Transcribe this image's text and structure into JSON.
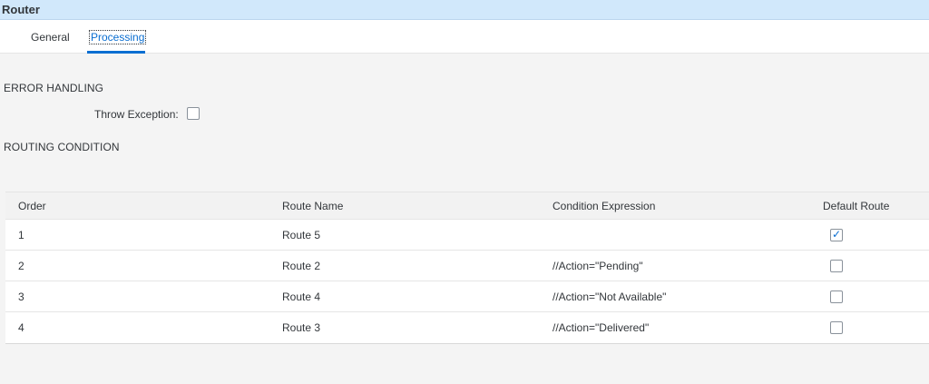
{
  "window": {
    "title": "Router"
  },
  "tabs": [
    {
      "label": "General",
      "active": false
    },
    {
      "label": "Processing",
      "active": true
    }
  ],
  "error_handling": {
    "heading": "ERROR HANDLING",
    "throw_exception_label": "Throw Exception:",
    "throw_exception_checked": false
  },
  "routing_condition": {
    "heading": "ROUTING CONDITION"
  },
  "table": {
    "columns": [
      "Order",
      "Route Name",
      "Condition Expression",
      "Default Route"
    ],
    "rows": [
      {
        "order": "1",
        "route_name": "Route 5",
        "condition": "",
        "default_route": true
      },
      {
        "order": "2",
        "route_name": "Route 2",
        "condition": "//Action=\"Pending\"",
        "default_route": false
      },
      {
        "order": "3",
        "route_name": "Route 4",
        "condition": "//Action=\"Not Available\"",
        "default_route": false
      },
      {
        "order": "4",
        "route_name": "Route 3",
        "condition": "//Action=\"Delivered\"",
        "default_route": false
      }
    ]
  },
  "colors": {
    "title_bar": "#d1e8fb",
    "accent": "#0a6ed1",
    "background": "#f4f4f4"
  }
}
